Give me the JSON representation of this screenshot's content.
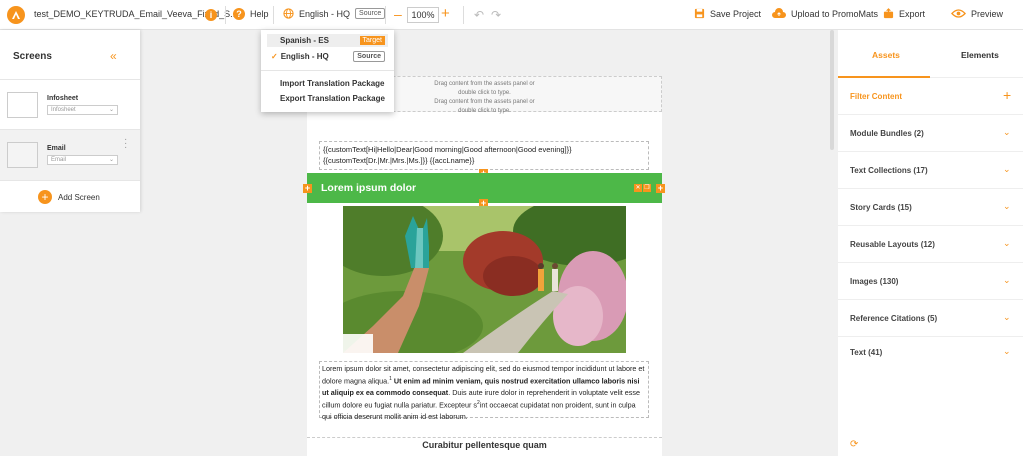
{
  "topbar": {
    "title": "test_DEMO_KEYTRUDA_Email_Veeva_Fixed_S...",
    "info_icon": "i",
    "help_label": "Help",
    "language_label": "English - HQ",
    "language_badge": "Source",
    "zoom_value": "100%",
    "save_label": "Save Project",
    "upload_label": "Upload to PromoMats",
    "export_label": "Export",
    "preview_label": "Preview",
    "accent_color": "#f7941d"
  },
  "language_menu": {
    "items": [
      {
        "label": "Spanish - ES",
        "badge": "Target"
      },
      {
        "label": "English - HQ",
        "badge": "Source"
      }
    ],
    "import_label": "Import Translation Package",
    "export_label": "Export Translation Package"
  },
  "screens_panel": {
    "title": "Screens",
    "screens": [
      {
        "name": "Infosheet",
        "select_value": "Infosheet"
      },
      {
        "name": "Email",
        "select_value": "Email"
      }
    ],
    "add_label": "Add Screen"
  },
  "canvas": {
    "drop_hint_1": "Drag content from the assets panel or",
    "drop_hint_2": "double click to type.",
    "drop_hint_3": "Drag content from the assets panel or",
    "drop_hint_4": "double click to type.",
    "custom_line_1": "{{customText[Hi|Hello|Dear|Good morning|Good afternoon|Good evening]}}",
    "custom_line_2": "{{customText[Dr.|Mr.|Mrs.|Ms.]}} {{accLname}}",
    "heading": "Lorem ipsum dolor",
    "body_1": "Lorem ipsum dolor sit amet, consectetur adipiscing elit, sed do eiusmod tempor incididunt ut labore et dolore magna aliqua.",
    "body_sup_1": "1",
    "body_bold": "Ut enim ad minim veniam, quis nostrud exercitation ullamco laboris nisi ut aliquip ex ea commodo consequat",
    "body_2": ". Duis aute irure dolor in reprehenderit in voluptate velit esse cillum dolore eu fugiat nulla pariatur. Excepteur s",
    "body_sup_2": "2",
    "body_3": "int occaecat cupidatat non proident, sunt in culpa qui officia deserunt mollit anim id est laborum.",
    "footer_heading": "Curabitur pellentesque quam",
    "heading_bar_color": "#4db848"
  },
  "assets_panel": {
    "tabs": [
      "Assets",
      "Elements"
    ],
    "filter_label": "Filter Content",
    "sections": [
      "Module Bundles (2)",
      "Text Collections (17)",
      "Story Cards (15)",
      "Reusable Layouts (12)",
      "Images (130)",
      "Reference Citations (5)",
      "Text (41)"
    ]
  }
}
